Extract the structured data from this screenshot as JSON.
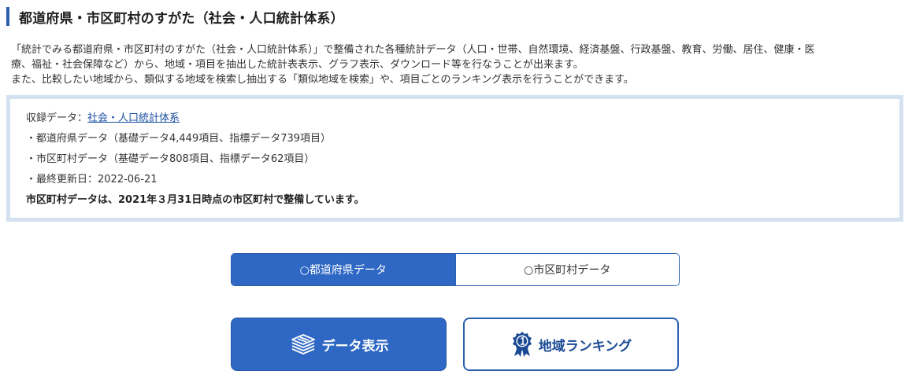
{
  "page": {
    "title": "都道府県・市区町村のすがた（社会・人口統計体系）"
  },
  "intro": {
    "line1": "「統計でみる都道府県・市区町村のすがた（社会・人口統計体系）」で整備された各種統計データ（人口・世帯、自然環境、経済基盤、行政基盤、教育、労働、居住、健康・医",
    "line2": "療、福祉・社会保障など）から、地域・項目を抽出した統計表表示、グラフ表示、ダウンロード等を行なうことが出来ます。",
    "line3": "また、比較したい地域から、類似する地域を検索し抽出する「類似地域を検索」や、項目ごとのランキング表示を行うことができます。"
  },
  "info": {
    "recorded_label": "収録データ：",
    "recorded_link": "社会・人口統計体系",
    "prefecture": "・都道府県データ（基礎データ4,449項目、指標データ739項目）",
    "municipality": "・市区町村データ（基礎データ808項目、指標データ62項目）",
    "updated": "・最終更新日：2022-06-21",
    "note": "市区町村データは、2021年３月31日時点の市区町村で整備しています。"
  },
  "toggle": {
    "option_prefecture": "○都道府県データ",
    "option_municipality": "○市区町村データ",
    "selected": "prefecture"
  },
  "actions": {
    "data_display": "データ表示",
    "ranking": "地域ランキング",
    "data_icon": "stacked-documents-icon",
    "ranking_icon": "ribbon-badge-icon"
  },
  "colors": {
    "accent": "#2f68c4",
    "box_border": "#d4e1f1",
    "link": "#1a4fa0"
  }
}
